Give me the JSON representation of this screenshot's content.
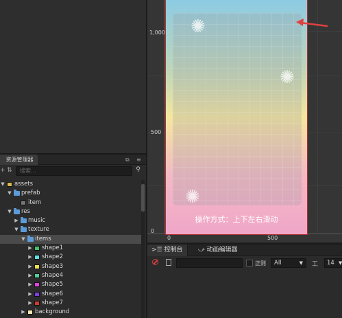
{
  "assets_panel": {
    "title": "资源管理器",
    "search_placeholder": "搜索...",
    "tree": [
      {
        "label": "assets",
        "depth": 0,
        "kind": "root",
        "expanded": true
      },
      {
        "label": "prefab",
        "depth": 1,
        "kind": "folder",
        "expanded": true
      },
      {
        "label": "item",
        "depth": 2,
        "kind": "prefab"
      },
      {
        "label": "res",
        "depth": 1,
        "kind": "folder",
        "expanded": true
      },
      {
        "label": "music",
        "depth": 2,
        "kind": "folder",
        "expanded": false
      },
      {
        "label": "texture",
        "depth": 2,
        "kind": "folder",
        "expanded": true
      },
      {
        "label": "items",
        "depth": 3,
        "kind": "folder",
        "expanded": true,
        "selected": true
      },
      {
        "label": "shape1",
        "depth": 4,
        "kind": "image",
        "color": "#3ec46d"
      },
      {
        "label": "shape2",
        "depth": 4,
        "kind": "image",
        "color": "#5de0e6"
      },
      {
        "label": "shape3",
        "depth": 4,
        "kind": "image",
        "color": "#f0e04a"
      },
      {
        "label": "shape4",
        "depth": 4,
        "kind": "image",
        "color": "#4ecf9a"
      },
      {
        "label": "shape5",
        "depth": 4,
        "kind": "image",
        "color": "#e040e0"
      },
      {
        "label": "shape6",
        "depth": 4,
        "kind": "image",
        "color": "#7a3de0"
      },
      {
        "label": "shape7",
        "depth": 4,
        "kind": "image",
        "color": "#d03a2a"
      },
      {
        "label": "background",
        "depth": 3,
        "kind": "image",
        "color": "#f0e6b0"
      }
    ]
  },
  "scene": {
    "y_labels": [
      "1,000",
      "500",
      "0"
    ],
    "x_labels": [
      "0",
      "500"
    ],
    "hint_text": "操作方式：上下左右滑动"
  },
  "console": {
    "tab_console": "控制台",
    "tab_animation": "动画编辑器",
    "regex_label": "正则",
    "level_value": "All",
    "font_size_value": "14"
  }
}
